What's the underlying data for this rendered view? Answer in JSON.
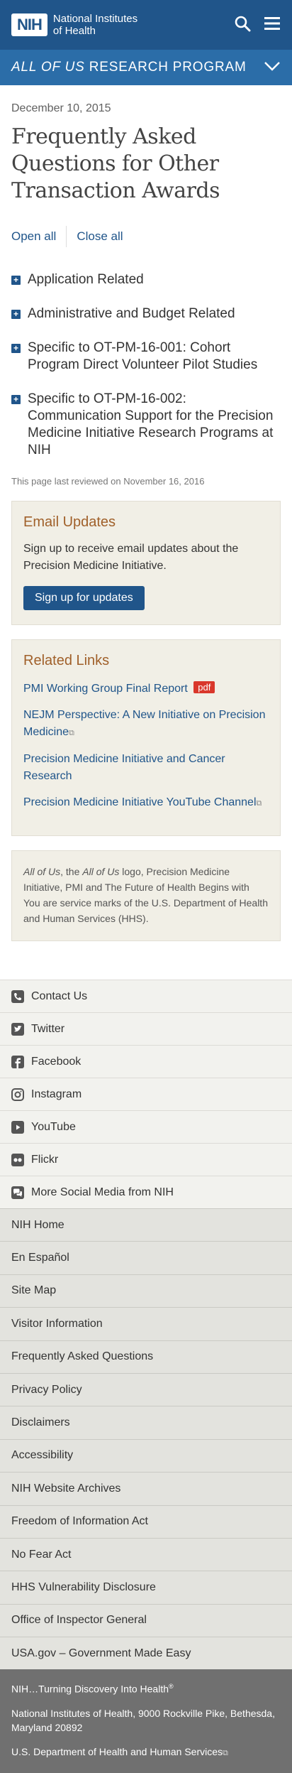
{
  "header": {
    "logo_mark": "NIH",
    "logo_line1": "National Institutes",
    "logo_line2": "of Health",
    "search_icon": "search-icon",
    "menu_icon": "hamburger-menu-icon"
  },
  "program": {
    "emph": "ALL OF US",
    "rest": " RESEARCH PROGRAM",
    "toggle_icon": "chevron-down-icon"
  },
  "main": {
    "date": "December 10, 2015",
    "title": "Frequently Asked Questions for Other Transaction Awards",
    "open_all": "Open all",
    "close_all": "Close all",
    "accordion": [
      {
        "label": "Application Related"
      },
      {
        "label": "Administrative and Budget Related"
      },
      {
        "label": "Specific to OT-PM-16-001: Cohort Program Direct Volunteer Pilot Studies"
      },
      {
        "label": "Specific to OT-PM-16-002: Communication Support for the Precision Medicine Initiative Research Programs at NIH"
      }
    ],
    "reviewed": "This page last reviewed on November 16, 2016"
  },
  "email_updates": {
    "title": "Email Updates",
    "text": "Sign up to receive email updates about the Precision Medicine Initiative.",
    "button": "Sign up for updates"
  },
  "related": {
    "title": "Related Links",
    "links": [
      {
        "label": "PMI Working Group Final Report",
        "badge": "pdf"
      },
      {
        "label": "NEJM Perspective: A New Initiative on Precision Medicine"
      },
      {
        "label": "Precision Medicine Initiative and Cancer Research"
      },
      {
        "label": "Precision Medicine Initiative YouTube Channel"
      }
    ]
  },
  "disclaimer": {
    "em1": "All of Us",
    "t1": ", the ",
    "em2": "All of Us",
    "t2": " logo, Precision Medicine Initiative, PMI and The Future of Health Begins with You are service marks of the U.S. Department of Health and Human Services (HHS)."
  },
  "social": [
    {
      "label": "Contact Us",
      "icon": "phone-icon"
    },
    {
      "label": "Twitter",
      "icon": "twitter-icon"
    },
    {
      "label": "Facebook",
      "icon": "facebook-icon"
    },
    {
      "label": "Instagram",
      "icon": "instagram-icon"
    },
    {
      "label": "YouTube",
      "icon": "youtube-icon"
    },
    {
      "label": "Flickr",
      "icon": "flickr-icon"
    },
    {
      "label": "More Social Media from NIH",
      "icon": "social-media-icon"
    }
  ],
  "footer_links": [
    "NIH Home",
    "En Español",
    "Site Map",
    "Visitor Information",
    "Frequently Asked Questions",
    "Privacy Policy",
    "Disclaimers",
    "Accessibility",
    "NIH Website Archives",
    "Freedom of Information Act",
    "No Fear Act",
    "HHS Vulnerability Disclosure",
    "Office of Inspector General",
    "USA.gov – Government Made Easy"
  ],
  "footer_bottom": {
    "tagline": "NIH…Turning Discovery Into Health",
    "trademark": "®",
    "address": "National Institutes of Health, 9000 Rockville Pike, Bethesda, Maryland 20892",
    "hhs": "U.S. Department of Health and Human Services"
  },
  "colors": {
    "header_blue": "#20558a",
    "program_blue": "#2b6da8",
    "link_blue": "#20558a",
    "heading_orange": "#a0602a",
    "pdf_red": "#d9372b",
    "footer_gray": "#707070"
  }
}
